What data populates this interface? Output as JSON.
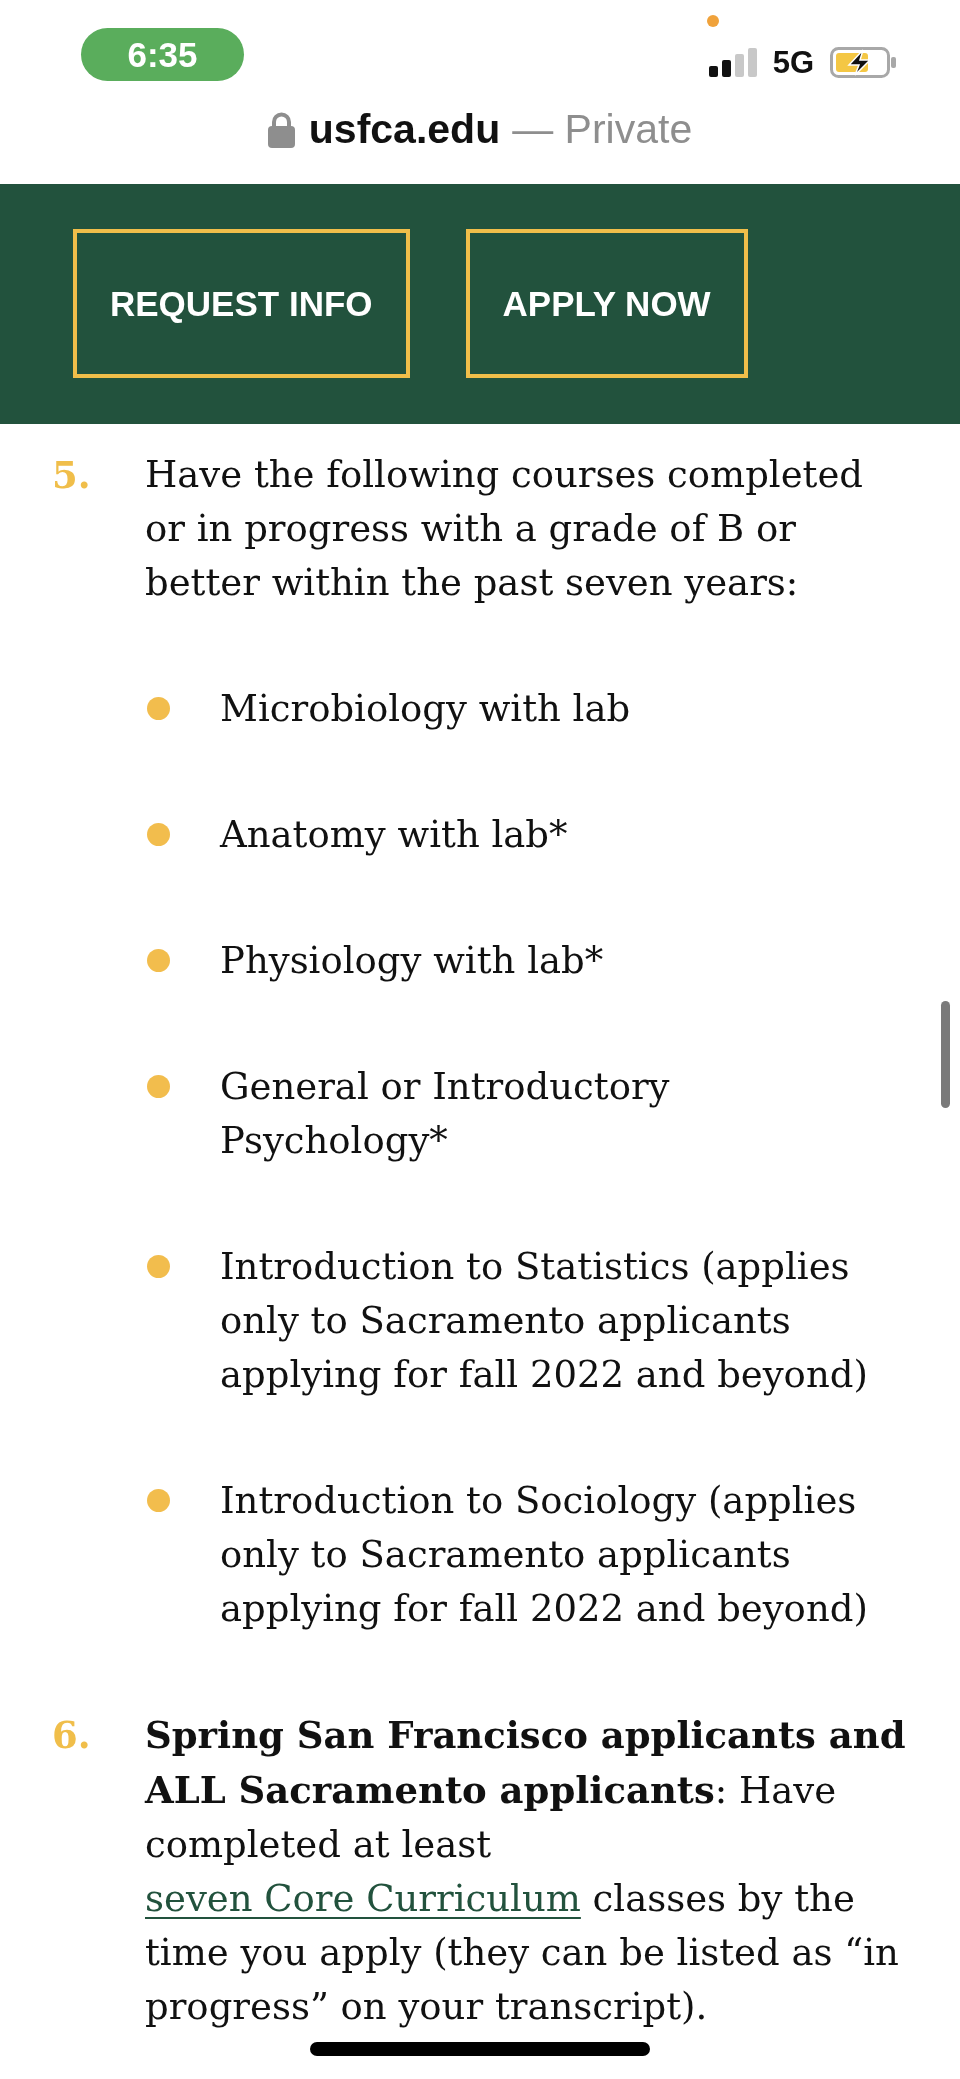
{
  "status_bar": {
    "time": "6:35",
    "network": "5G"
  },
  "address_bar": {
    "domain": "usfca.edu",
    "mode": "— Private"
  },
  "header": {
    "buttons": [
      {
        "label": "REQUEST INFO"
      },
      {
        "label": "APPLY NOW"
      }
    ]
  },
  "requirements": [
    {
      "number": "5.",
      "parts": [
        {
          "kind": "text",
          "text": "Have the following courses completed or in progress with a grade of B or better within the past seven years:"
        }
      ],
      "bullets": [
        "Microbiology with lab",
        "Anatomy with lab*",
        "Physiology with lab*",
        "General or Introductory Psychology*",
        "Introduction to Statistics (applies only to Sacramento applicants applying for fall 2022 and beyond)",
        "Introduction to Sociology (applies only to Sacramento applicants applying for fall 2022 and beyond)"
      ]
    },
    {
      "number": "6.",
      "parts": [
        {
          "kind": "text",
          "text": "**Spring San Francisco applicants and ALL Sacramento applicants**: Have completed at least "
        },
        {
          "kind": "link",
          "text": "seven Core Curriculum"
        },
        {
          "kind": "text",
          "text": " classes by the time you apply (they can be listed as “in progress” on your transcript)."
        }
      ]
    }
  ]
}
